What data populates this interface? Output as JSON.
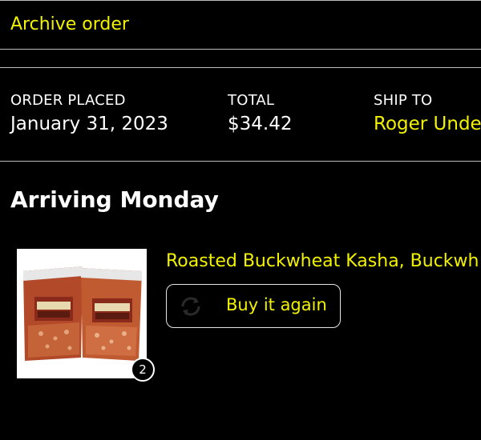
{
  "archive": {
    "label": "Archive order"
  },
  "order": {
    "placed_label": "ORDER PLACED",
    "placed_value": "January 31, 2023",
    "total_label": "TOTAL",
    "total_value": "$34.42",
    "ship_label": "SHIP TO",
    "ship_value": "Roger Unde"
  },
  "shipment": {
    "status": "Arriving Monday"
  },
  "item": {
    "title": "Roasted Buckwheat Kasha, Buckwh",
    "quantity": "2",
    "buy_again_label": "Buy it again",
    "buy_again_icon": "buy-again-cycle-icon"
  },
  "colors": {
    "link": "#f2f200",
    "background": "#000000",
    "text": "#ffffff",
    "divider": "#bdbdbd"
  }
}
